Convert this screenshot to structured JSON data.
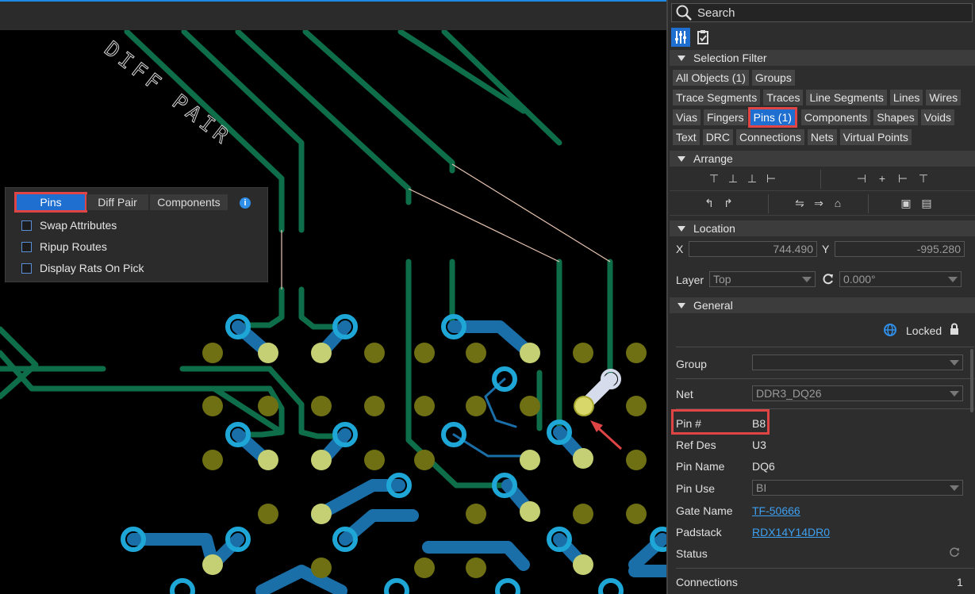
{
  "pcb": {
    "silkscreen_text": "DIFF PAIR"
  },
  "pick_panel": {
    "tabs": [
      {
        "label": "Pins",
        "active": true
      },
      {
        "label": "Diff Pair",
        "active": false
      },
      {
        "label": "Components",
        "active": false
      }
    ],
    "options": [
      {
        "label": "Swap Attributes",
        "checked": false
      },
      {
        "label": "Ripup Routes",
        "checked": false
      },
      {
        "label": "Display Rats On Pick",
        "checked": false
      }
    ]
  },
  "sidebar": {
    "search_placeholder": "Search",
    "selection_filter": {
      "title": "Selection Filter",
      "rows": [
        [
          "All Objects (1)",
          "Groups"
        ],
        [
          "Trace Segments",
          "Traces",
          "Line Segments",
          "Lines",
          "Wires"
        ],
        [
          "Vias",
          "Fingers",
          "Pins (1)",
          "Components",
          "Shapes",
          "Voids"
        ],
        [
          "Text",
          "DRC",
          "Connections",
          "Nets",
          "Virtual Points"
        ]
      ],
      "active_chip": "Pins (1)"
    },
    "arrange": {
      "title": "Arrange"
    },
    "location": {
      "title": "Location",
      "x_label": "X",
      "x_value": "744.490",
      "y_label": "Y",
      "y_value": "-995.280",
      "layer_label": "Layer",
      "layer_value": "Top",
      "rotation_value": "0.000°"
    },
    "general": {
      "title": "General",
      "locked_label": "Locked",
      "group_label": "Group",
      "group_value": "",
      "net_label": "Net",
      "net_value": "DDR3_DQ26",
      "pin_label": "Pin #",
      "pin_value": "B8",
      "refdes_label": "Ref Des",
      "refdes_value": "U3",
      "pinname_label": "Pin Name",
      "pinname_value": "DQ6",
      "pinuse_label": "Pin Use",
      "pinuse_value": "BI",
      "gatename_label": "Gate Name",
      "gatename_value": "TF-50666",
      "padstack_label": "Padstack",
      "padstack_value": "RDX14Y14DR0",
      "status_label": "Status",
      "connections_label": "Connections",
      "connections_value": "1"
    }
  },
  "colors": {
    "accent": "#1e6fd0",
    "highlight": "#e04545",
    "trace_green": "#0f6e4a",
    "trace_blue": "#1a6fa8",
    "via_cyan": "#1ea7d6",
    "pad_olive": "#7a7a18"
  }
}
